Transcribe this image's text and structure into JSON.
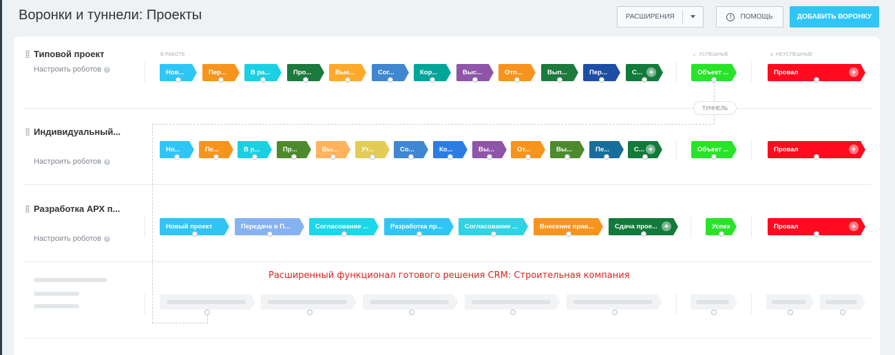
{
  "header": {
    "title": "Воронки и туннели: Проекты",
    "extensions_label": "РАСШИРЕНИЯ",
    "help_label": "ПОМОЩЬ",
    "add_funnel_label": "ДОБАВИТЬ ВОРОНКУ"
  },
  "columns": {
    "in_work": "В РАБОТЕ",
    "success": "УСПЕШНЫЕ",
    "failure": "НЕУСПЕШНЫЕ"
  },
  "tunnel_label": "ТУННЕЛЬ",
  "note": "Расширенный функционал готового решения CRM: Строительная компания",
  "funnels": [
    {
      "name": "Типовой проект",
      "robots_label": "Настроить роботов",
      "stages": [
        {
          "label": "Нов...",
          "color": "#2fc6f6"
        },
        {
          "label": "Пер...",
          "color": "#f7941d"
        },
        {
          "label": "В ра...",
          "color": "#1bd0e3"
        },
        {
          "label": "Про...",
          "color": "#1c7a3c"
        },
        {
          "label": "Вые...",
          "color": "#ffa92a"
        },
        {
          "label": "Сог...",
          "color": "#3f87d0"
        },
        {
          "label": "Кор...",
          "color": "#00a59a"
        },
        {
          "label": "Выс...",
          "color": "#8e55a8"
        },
        {
          "label": "Отп...",
          "color": "#f7941d"
        },
        {
          "label": "Вып...",
          "color": "#1c7a3c"
        },
        {
          "label": "Пер...",
          "color": "#1d4ea6"
        },
        {
          "label": "С...",
          "color": "#127a3a"
        }
      ],
      "success": [
        {
          "label": "Объект ...",
          "color": "#29e329"
        }
      ],
      "failure": [
        {
          "label": "Провал",
          "color": "#ff0a1e"
        }
      ]
    },
    {
      "name": "Индивидуальный...",
      "robots_label": "Настроить роботов",
      "stages": [
        {
          "label": "Но...",
          "color": "#2fc6f6"
        },
        {
          "label": "Пе...",
          "color": "#f7941d"
        },
        {
          "label": "В р...",
          "color": "#1bd0e3"
        },
        {
          "label": "Пр...",
          "color": "#4d8a2e"
        },
        {
          "label": "Вы...",
          "color": "#ffb35c"
        },
        {
          "label": "Ут...",
          "color": "#e3cc55"
        },
        {
          "label": "Со...",
          "color": "#3f87d0"
        },
        {
          "label": "Ко...",
          "color": "#2b7de3"
        },
        {
          "label": "Вы...",
          "color": "#8e55a8"
        },
        {
          "label": "От...",
          "color": "#f7941d"
        },
        {
          "label": "Вы...",
          "color": "#4d8a2e"
        },
        {
          "label": "Пе...",
          "color": "#176d9c"
        },
        {
          "label": "С...",
          "color": "#127a3a"
        }
      ],
      "success": [
        {
          "label": "Объект ...",
          "color": "#29e329"
        }
      ],
      "failure": [
        {
          "label": "Провал",
          "color": "#ff0a1e"
        }
      ]
    },
    {
      "name": "Разработка АРХ п...",
      "robots_label": "Настроить роботов",
      "stages": [
        {
          "label": "Новый проект",
          "color": "#2fc6f6"
        },
        {
          "label": "Передача в П...",
          "color": "#86b2f2"
        },
        {
          "label": "Согласование ...",
          "color": "#1bd8e8"
        },
        {
          "label": "Разработка пр...",
          "color": "#2fc6f6"
        },
        {
          "label": "Согласование ...",
          "color": "#2dd4e4"
        },
        {
          "label": "Внесение прав...",
          "color": "#f7941d"
        },
        {
          "label": "Сдача прое...",
          "color": "#127a3a"
        }
      ],
      "success": [
        {
          "label": "Успех",
          "color": "#29e329"
        }
      ],
      "failure": [
        {
          "label": "Провал",
          "color": "#ff0a1e"
        }
      ]
    }
  ]
}
